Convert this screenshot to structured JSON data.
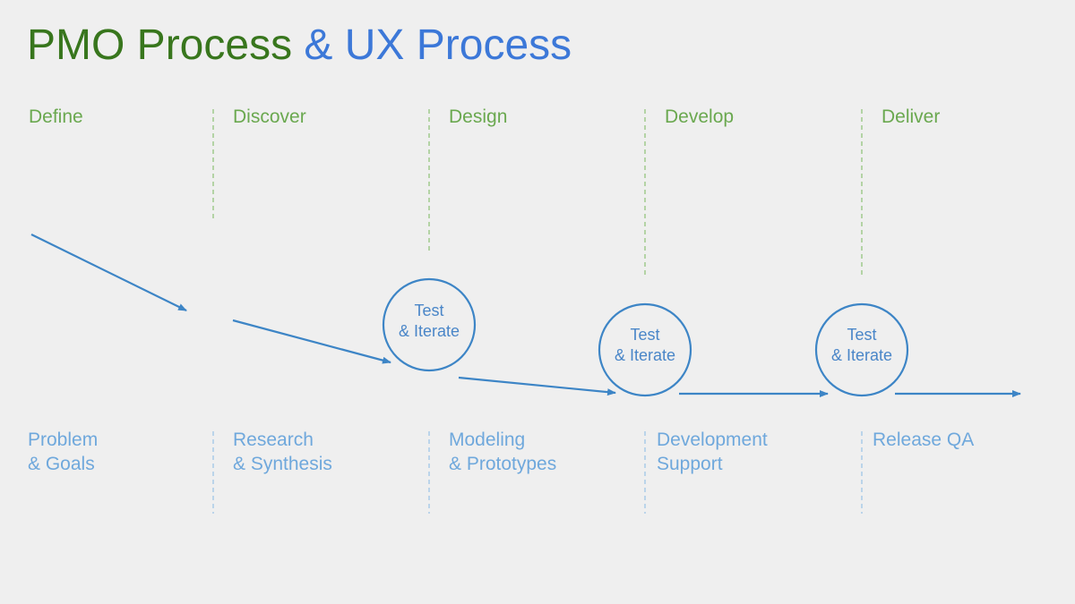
{
  "title": {
    "part1": "PMO Process",
    "part2": "& UX Process"
  },
  "phases": [
    "Define",
    "Discover",
    "Design",
    "Develop",
    "Deliver"
  ],
  "activities": [
    [
      "Problem",
      "& Goals"
    ],
    [
      "Research",
      "& Synthesis"
    ],
    [
      "Modeling",
      "& Prototypes"
    ],
    [
      "Development",
      "Support"
    ],
    [
      "Release QA"
    ]
  ],
  "test_iterate": {
    "line1": "Test",
    "line2": "& Iterate"
  },
  "colors": {
    "pmo_green": "#38761d",
    "phase_green": "#6aa84f",
    "ux_blue": "#3c78d8",
    "activity_blue": "#6fa8dc",
    "arrow_blue": "#3d85c6",
    "background": "#efefef"
  }
}
